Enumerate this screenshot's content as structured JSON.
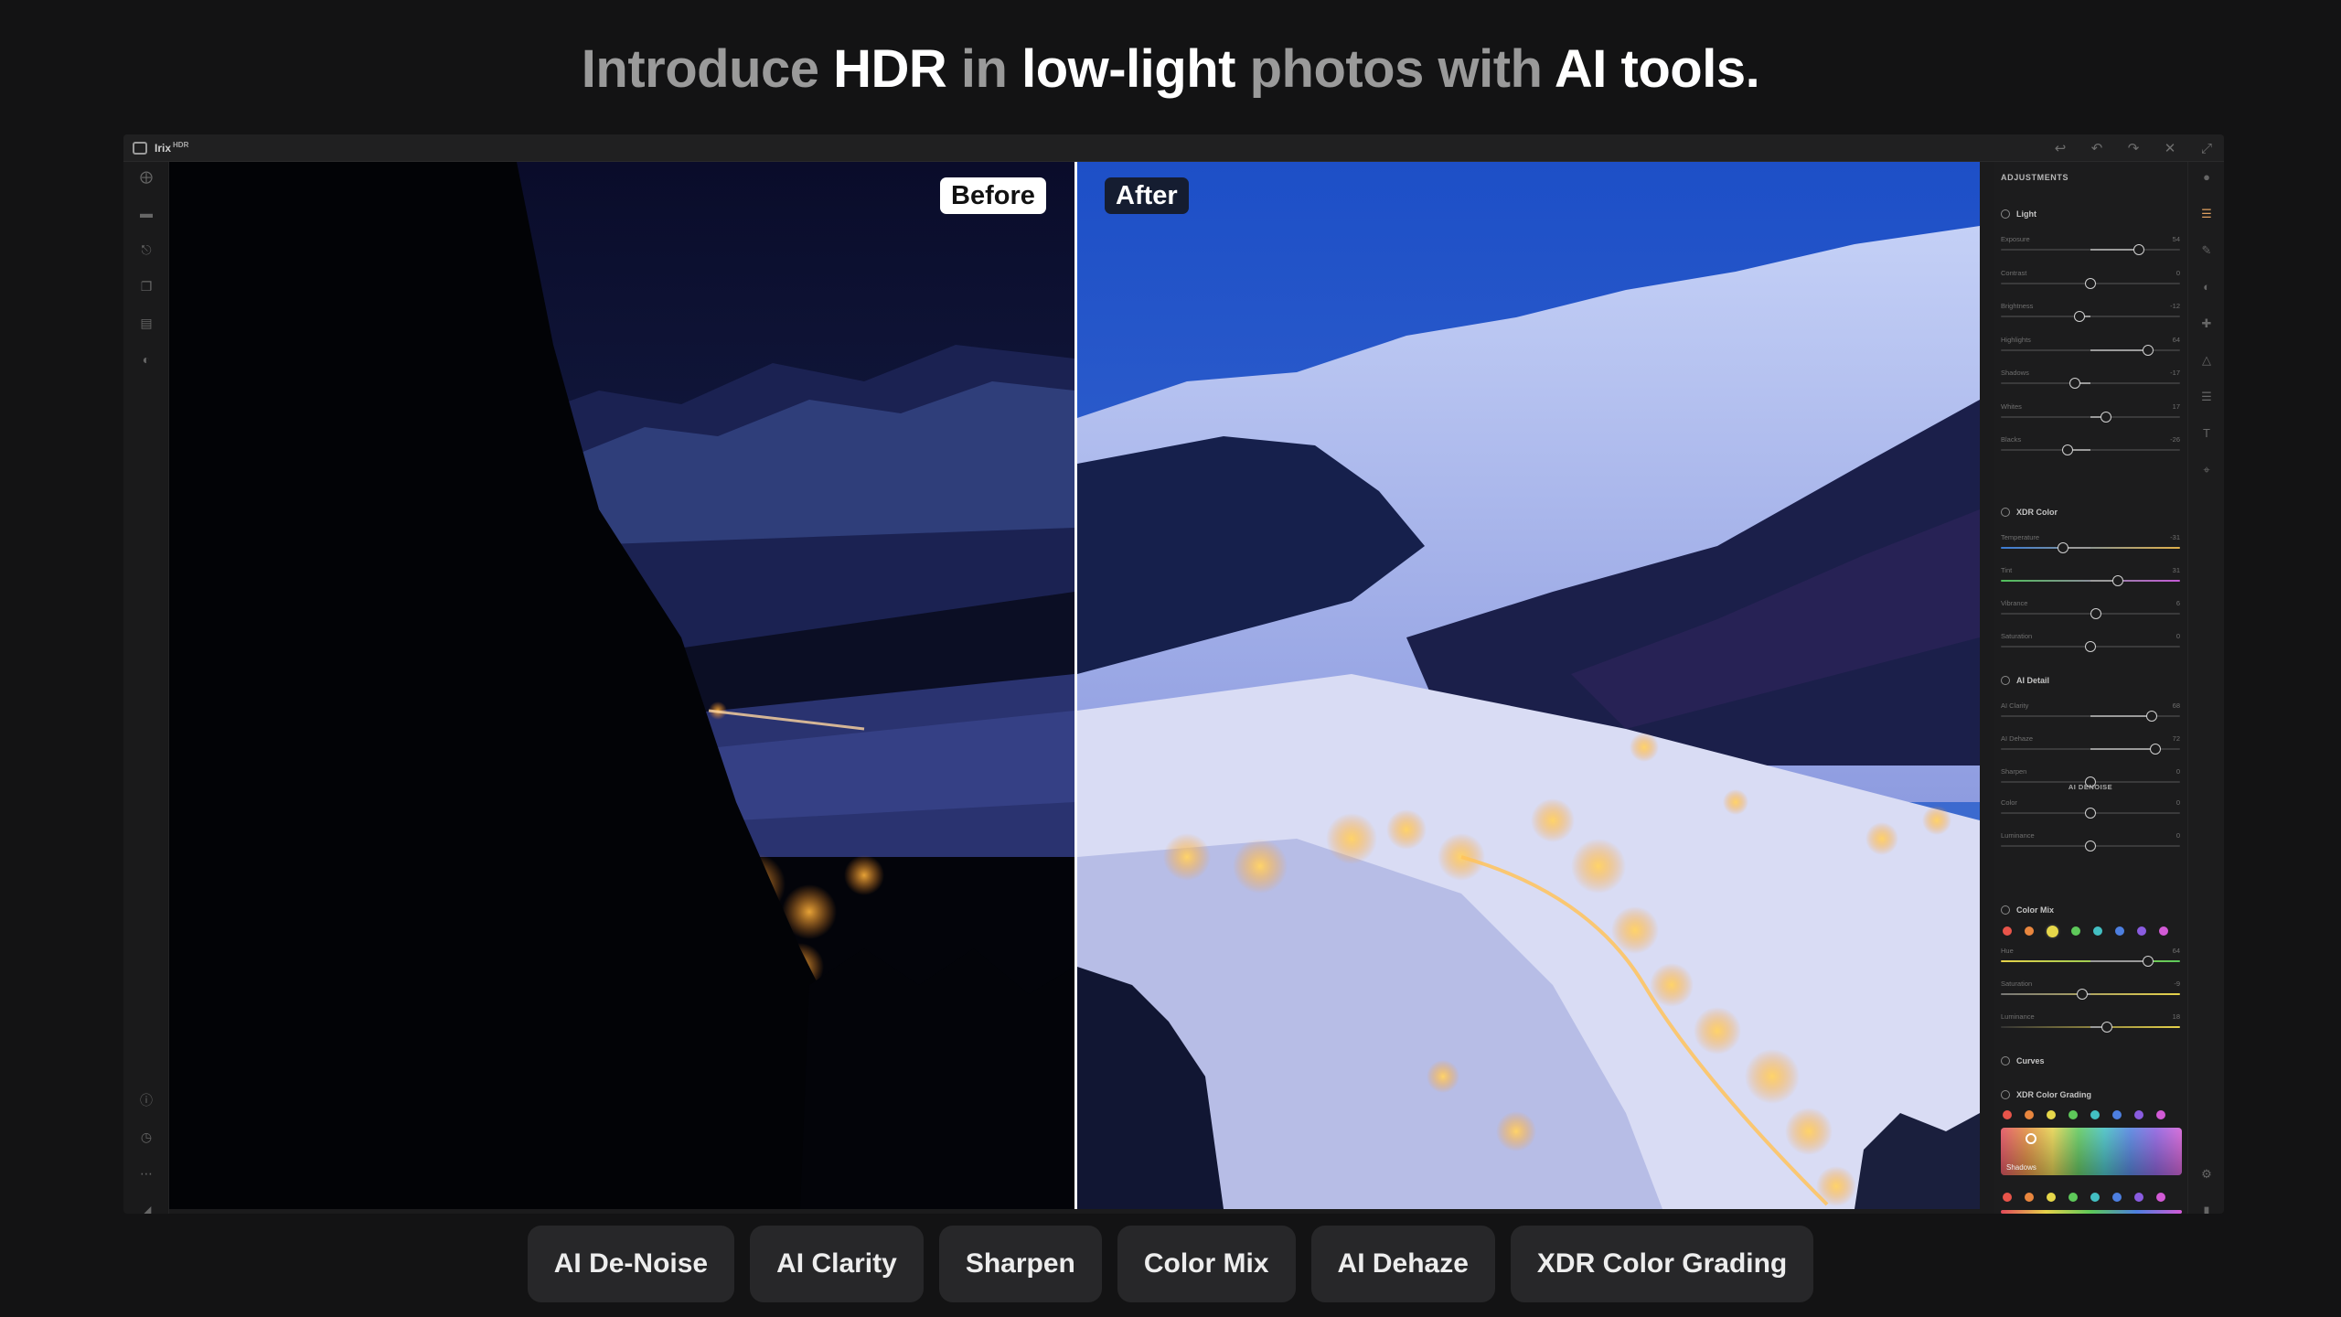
{
  "headline": {
    "p1": "Introduce ",
    "p2": "HDR",
    "p3": " in ",
    "p4": "low-light",
    "p5": " photos with ",
    "p6": "AI tools."
  },
  "app": {
    "name": "Irix",
    "badge": "HDR"
  },
  "compare": {
    "before_label": "Before",
    "after_label": "After"
  },
  "panel": {
    "title": "ADJUSTMENTS",
    "light": {
      "title": "Light",
      "sliders": [
        {
          "label": "Exposure",
          "value": 54
        },
        {
          "label": "Contrast",
          "value": 0
        },
        {
          "label": "Brightness",
          "value": -12
        },
        {
          "label": "Highlights",
          "value": 64
        },
        {
          "label": "Shadows",
          "value": -17
        },
        {
          "label": "Whites",
          "value": 17
        },
        {
          "label": "Blacks",
          "value": -26
        }
      ]
    },
    "xdr_color": {
      "title": "XDR Color",
      "sliders": [
        {
          "label": "Temperature",
          "value": -31
        },
        {
          "label": "Tint",
          "value": 31
        },
        {
          "label": "Vibrance",
          "value": 6
        },
        {
          "label": "Saturation",
          "value": 0
        }
      ]
    },
    "ai_detail": {
      "title": "AI Detail",
      "sliders": [
        {
          "label": "AI Clarity",
          "value": 68
        },
        {
          "label": "AI Dehaze",
          "value": 72
        },
        {
          "label": "Sharpen",
          "value": 0
        }
      ],
      "denoise_title": "AI DENOISE",
      "denoise_sliders": [
        {
          "label": "Color",
          "value": 0
        },
        {
          "label": "Luminance",
          "value": 0
        }
      ]
    },
    "color_mix": {
      "title": "Color Mix",
      "sliders": [
        {
          "label": "Hue",
          "value": 64
        },
        {
          "label": "Saturation",
          "value": -9
        },
        {
          "label": "Luminance",
          "value": 18
        }
      ]
    },
    "curves": {
      "title": "Curves"
    },
    "xdr_grading": {
      "title": "XDR Color Grading",
      "shadows_label": "Shadows"
    },
    "swatches": [
      "#e8544a",
      "#e9863e",
      "#e6d74a",
      "#5ec95a",
      "#43bfc2",
      "#4d7fe0",
      "#8a5ce0",
      "#d25ad6"
    ]
  },
  "features": [
    "AI De-Noise",
    "AI Clarity",
    "Sharpen",
    "Color Mix",
    "AI Dehaze",
    "XDR Color Grading"
  ]
}
